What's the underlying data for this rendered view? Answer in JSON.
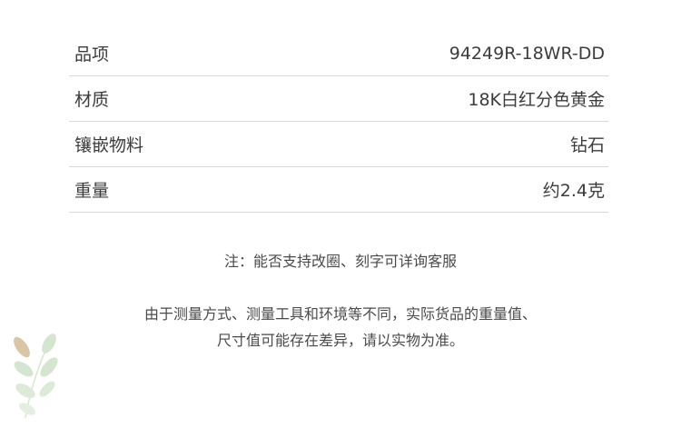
{
  "specs": [
    {
      "label": "品项",
      "value": "94249R-18WR-DD"
    },
    {
      "label": "材质",
      "value": "18K白红分色黄金"
    },
    {
      "label": "镶嵌物料",
      "value": "钻石"
    },
    {
      "label": "重量",
      "value": "约2.4克"
    }
  ],
  "note": "注：能否支持改圈、刻字可详询客服",
  "disclaimer": {
    "line1": "由于测量方式、测量工具和环境等不同，实际货品的重量值、",
    "line2": "尺寸值可能存在差异，请以实物为准。"
  },
  "colors": {
    "text": "#3c3c3c",
    "divider": "#d9d9d9",
    "leaf_green": "#cfe3c9",
    "leaf_tan": "#d8c6a4"
  },
  "icons": [
    "leaf-decoration-icon"
  ]
}
